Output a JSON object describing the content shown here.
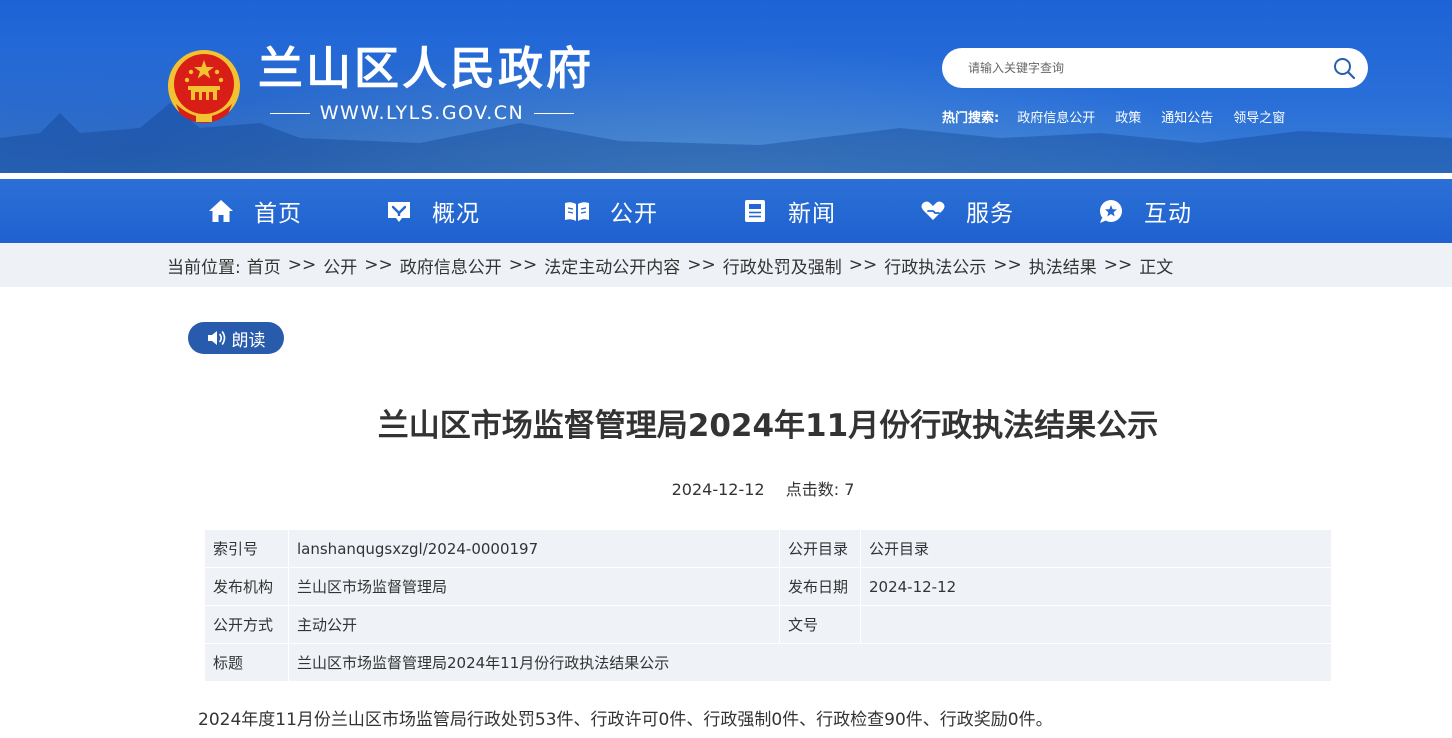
{
  "header": {
    "site_title": "兰山区人民政府",
    "site_url": "WWW.LYLS.GOV.CN",
    "search": {
      "placeholder": "请输入关键字查询"
    },
    "hot_search": {
      "label": "热门搜索:",
      "items": [
        "政府信息公开",
        "政策",
        "通知公告",
        "领导之窗"
      ]
    }
  },
  "nav": {
    "items": [
      {
        "label": "首页",
        "icon": "home-icon"
      },
      {
        "label": "概况",
        "icon": "overview-icon"
      },
      {
        "label": "公开",
        "icon": "book-icon"
      },
      {
        "label": "新闻",
        "icon": "news-icon"
      },
      {
        "label": "服务",
        "icon": "heart-hand-icon"
      },
      {
        "label": "互动",
        "icon": "chat-star-icon"
      }
    ]
  },
  "breadcrumb": {
    "prefix": "当前位置:",
    "separator": ">>",
    "items": [
      "首页",
      "公开",
      "政府信息公开",
      "法定主动公开内容",
      "行政处罚及强制",
      "行政执法公示",
      "执法结果",
      "正文"
    ]
  },
  "read_button": {
    "label": "朗读"
  },
  "article": {
    "title": "兰山区市场监督管理局2024年11月份行政执法结果公示",
    "date": "2024-12-12",
    "hits_label": "点击数:",
    "hits": "7",
    "body": "2024年度11月份兰山区市场监管局行政处罚53件、行政许可0件、行政强制0件、行政检查90件、行政奖励0件。"
  },
  "info_table": {
    "rows": [
      {
        "k1": "索引号",
        "v1": "lanshanqugsxzgl/2024-0000197",
        "k2": "公开目录",
        "v2": "公开目录"
      },
      {
        "k1": "发布机构",
        "v1": "兰山区市场监督管理局",
        "k2": "发布日期",
        "v2": "2024-12-12"
      },
      {
        "k1": "公开方式",
        "v1": "主动公开",
        "k2": "文号",
        "v2": ""
      }
    ],
    "title_row": {
      "k": "标题",
      "v": "兰山区市场监督管理局2024年11月份行政执法结果公示"
    }
  },
  "colors": {
    "header_blue": "#1d63d6",
    "nav_blue": "#2b6fd6",
    "read_button": "#295bad",
    "breadcrumb_bg": "#eef1f5",
    "table_bg": "#eff2f6",
    "emblem_red": "#d91e18",
    "emblem_gold": "#f2c230"
  }
}
